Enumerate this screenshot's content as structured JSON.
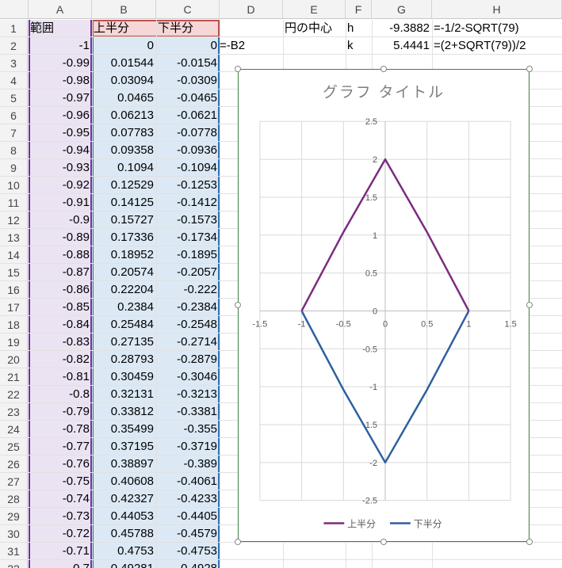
{
  "columns": [
    "A",
    "B",
    "C",
    "D",
    "E",
    "F",
    "G",
    "H"
  ],
  "row_numbers": [
    "1",
    "2",
    "3",
    "4",
    "5",
    "6",
    "7",
    "8",
    "9",
    "10",
    "11",
    "12",
    "13",
    "14",
    "15",
    "16",
    "17",
    "18",
    "19",
    "20",
    "21",
    "22",
    "23",
    "24",
    "25",
    "26",
    "27",
    "28",
    "29",
    "30",
    "31",
    "32"
  ],
  "cells": {
    "A1": "範囲",
    "B1": "上半分",
    "C1": "下半分",
    "E1": "円の中心",
    "F1": "h",
    "G1": "-9.3882",
    "H1": "=-1/2-SQRT(79)",
    "D2": "=-B2",
    "F2": "k",
    "G2": "5.4441",
    "H2": "=(2+SQRT(79))/2"
  },
  "rows_data": [
    [
      "-1",
      "0",
      "0"
    ],
    [
      "-0.99",
      "0.01544",
      "-0.0154"
    ],
    [
      "-0.98",
      "0.03094",
      "-0.0309"
    ],
    [
      "-0.97",
      "0.0465",
      "-0.0465"
    ],
    [
      "-0.96",
      "0.06213",
      "-0.0621"
    ],
    [
      "-0.95",
      "0.07783",
      "-0.0778"
    ],
    [
      "-0.94",
      "0.09358",
      "-0.0936"
    ],
    [
      "-0.93",
      "0.1094",
      "-0.1094"
    ],
    [
      "-0.92",
      "0.12529",
      "-0.1253"
    ],
    [
      "-0.91",
      "0.14125",
      "-0.1412"
    ],
    [
      "-0.9",
      "0.15727",
      "-0.1573"
    ],
    [
      "-0.89",
      "0.17336",
      "-0.1734"
    ],
    [
      "-0.88",
      "0.18952",
      "-0.1895"
    ],
    [
      "-0.87",
      "0.20574",
      "-0.2057"
    ],
    [
      "-0.86",
      "0.22204",
      "-0.222"
    ],
    [
      "-0.85",
      "0.2384",
      "-0.2384"
    ],
    [
      "-0.84",
      "0.25484",
      "-0.2548"
    ],
    [
      "-0.83",
      "0.27135",
      "-0.2714"
    ],
    [
      "-0.82",
      "0.28793",
      "-0.2879"
    ],
    [
      "-0.81",
      "0.30459",
      "-0.3046"
    ],
    [
      "-0.8",
      "0.32131",
      "-0.3213"
    ],
    [
      "-0.79",
      "0.33812",
      "-0.3381"
    ],
    [
      "-0.78",
      "0.35499",
      "-0.355"
    ],
    [
      "-0.77",
      "0.37195",
      "-0.3719"
    ],
    [
      "-0.76",
      "0.38897",
      "-0.389"
    ],
    [
      "-0.75",
      "0.40608",
      "-0.4061"
    ],
    [
      "-0.74",
      "0.42327",
      "-0.4233"
    ],
    [
      "-0.73",
      "0.44053",
      "-0.4405"
    ],
    [
      "-0.72",
      "0.45788",
      "-0.4579"
    ],
    [
      "-0.71",
      "0.4753",
      "-0.4753"
    ],
    [
      "-0.7",
      "0.49281",
      "-0.4928"
    ]
  ],
  "colors": {
    "upper_series": "#7b2c7f",
    "lower_series": "#2e5f9e",
    "col_a_fill": "#ebe3f2",
    "col_bc_fill": "#dce9f5",
    "header_b_fill": "#f6d6d6",
    "header_border": "#c0504d"
  },
  "chart_data": {
    "type": "line",
    "title": "グラフ タイトル",
    "xlim": [
      -1.5,
      1.5
    ],
    "ylim": [
      -2.5,
      2.5
    ],
    "x_ticks": [
      -1.5,
      -1,
      -0.5,
      0,
      0.5,
      1,
      1.5
    ],
    "y_ticks": [
      -2.5,
      -2,
      -1.5,
      -1,
      -0.5,
      0,
      0.5,
      1,
      1.5,
      2,
      2.5
    ],
    "tick_labels_x": [
      "-1.5",
      "-1",
      "-0.5",
      "0",
      "0.5",
      "1",
      "1.5"
    ],
    "tick_labels_y": [
      "-2.5",
      "-2",
      "-1.5",
      "-1",
      "-0.5",
      "0",
      "0.5",
      "1",
      "1.5",
      "2",
      "2.5"
    ],
    "grid": true,
    "legend_position": "bottom",
    "series": [
      {
        "name": "上半分",
        "x": [
          -1,
          -0.5,
          0,
          0.5,
          1
        ],
        "y": [
          0,
          1.04,
          2,
          1.04,
          0
        ]
      },
      {
        "name": "下半分",
        "x": [
          -1,
          -0.5,
          0,
          0.5,
          1
        ],
        "y": [
          0,
          -1.04,
          -2,
          -1.04,
          0
        ]
      }
    ]
  }
}
